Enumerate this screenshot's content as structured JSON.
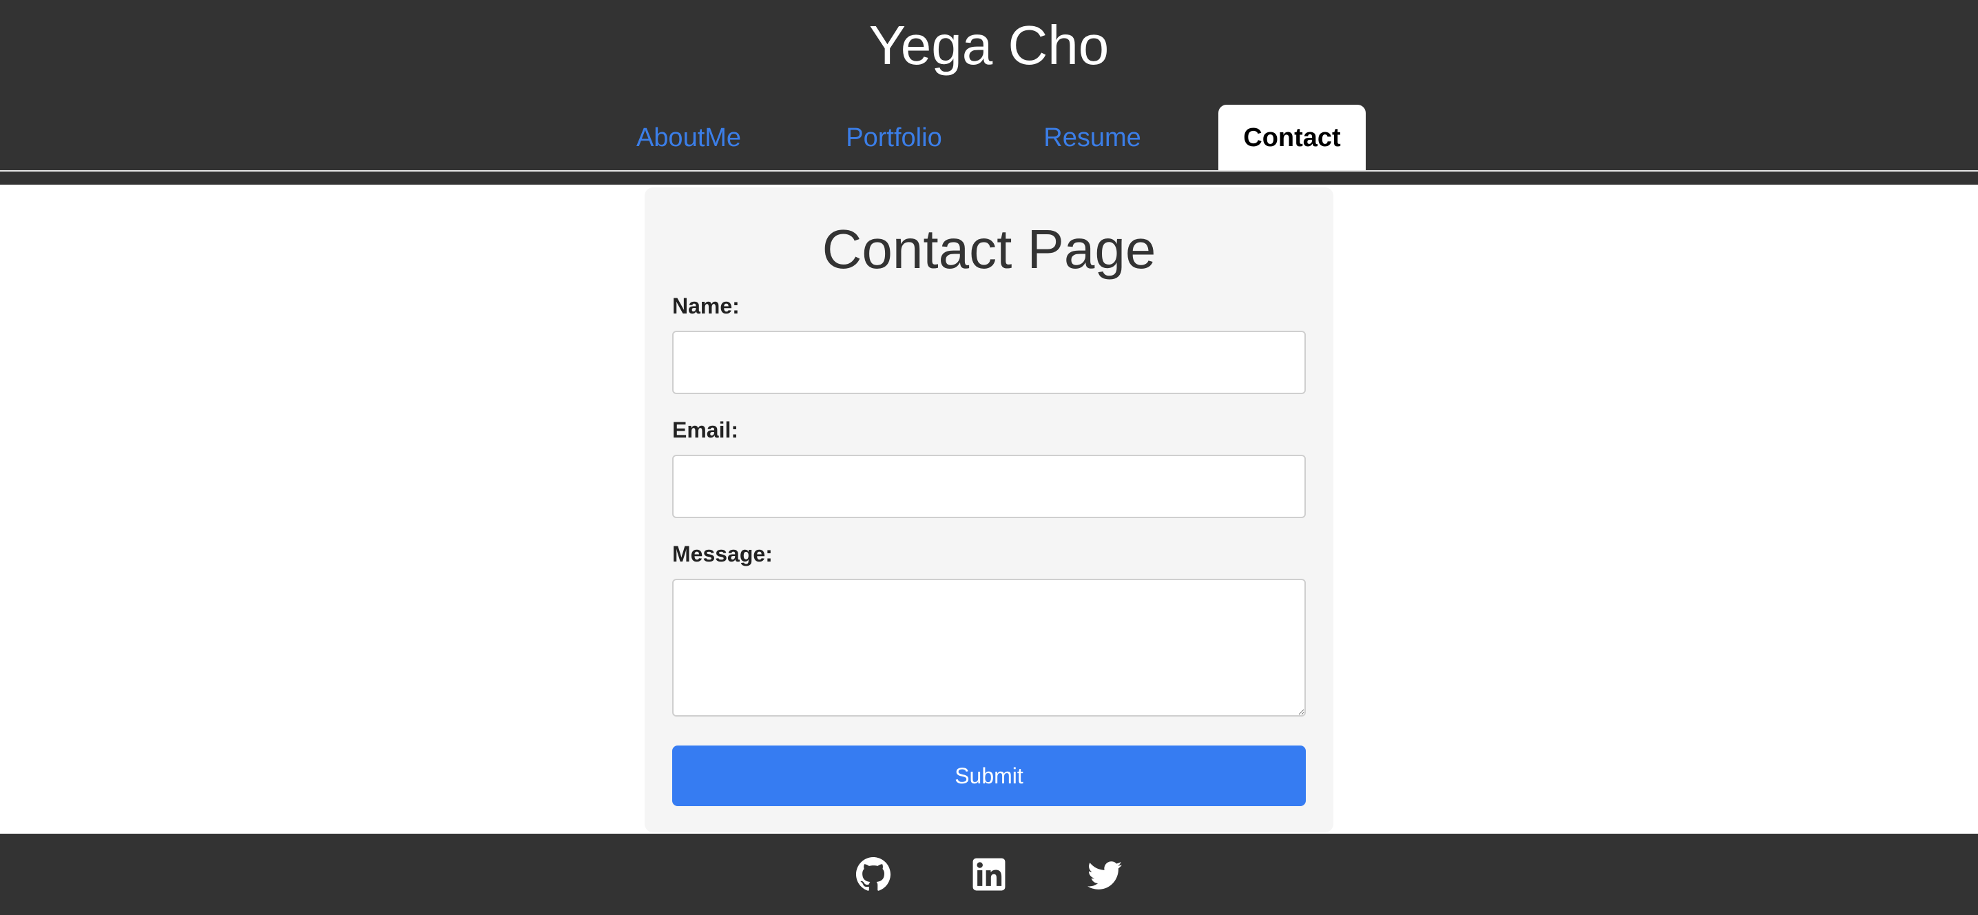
{
  "header": {
    "site_title": "Yega Cho",
    "nav": [
      {
        "label": "AboutMe",
        "active": false
      },
      {
        "label": "Portfolio",
        "active": false
      },
      {
        "label": "Resume",
        "active": false
      },
      {
        "label": "Contact",
        "active": true
      }
    ]
  },
  "contact_form": {
    "title": "Contact Page",
    "fields": [
      {
        "label": "Name:",
        "value": "",
        "type": "text"
      },
      {
        "label": "Email:",
        "value": "",
        "type": "email"
      },
      {
        "label": "Message:",
        "value": "",
        "type": "textarea"
      }
    ],
    "submit_label": "Submit"
  },
  "footer": {
    "icons": [
      "github-icon",
      "linkedin-icon",
      "twitter-icon"
    ]
  },
  "colors": {
    "header_bg": "#333333",
    "nav_link": "#3b7ee8",
    "card_bg": "#f5f5f5",
    "accent_button": "#367cf2",
    "footer_bg": "#333333"
  }
}
